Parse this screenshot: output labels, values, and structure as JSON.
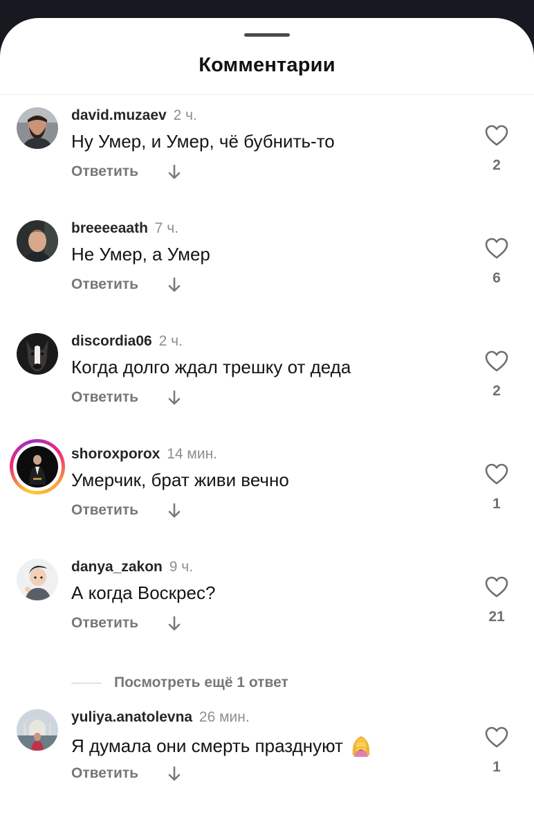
{
  "sheet": {
    "title": "Комментарии"
  },
  "comments": [
    {
      "username": "david.muzaev",
      "time": "2 ч.",
      "text": "Ну Умер, и Умер, чё бубнить-то",
      "reply_label": "Ответить",
      "likes": "2",
      "avatar_icon": "bearded-man-photo"
    },
    {
      "username": "breeeeaath",
      "time": "7 ч.",
      "text": "Не Умер, а Умер",
      "reply_label": "Ответить",
      "likes": "6",
      "avatar_icon": "man-portrait-photo"
    },
    {
      "username": "discordia06",
      "time": "2 ч.",
      "text": "Когда долго ждал трешку от деда",
      "reply_label": "Ответить",
      "likes": "2",
      "avatar_icon": "dog-photo"
    },
    {
      "username": "shoroxporox",
      "time": "14 мин.",
      "text": "Умерчик, брат живи вечно",
      "reply_label": "Ответить",
      "likes": "1",
      "avatar_icon": "man-in-suit-photo",
      "has_story_ring": true
    },
    {
      "username": "danya_zakon",
      "time": "9 ч.",
      "text": "А когда Воскрес?",
      "reply_label": "Ответить",
      "likes": "21",
      "avatar_icon": "cartoon-avatar"
    },
    {
      "username": "yuliya.anatolevna",
      "time": "26 мин.",
      "text": "Я думала они смерть празднуют",
      "reply_label": "Ответить",
      "likes": "1",
      "avatar_icon": "woman-at-taj-mahal-photo",
      "emoji": "woman-facepalming-emoji"
    }
  ],
  "view_more_replies": "Посмотреть ещё 1 ответ",
  "colors": {
    "background_dark": "#161a20",
    "sheet": "#ffffff",
    "username": "#262626",
    "secondary_text": "#8e8e8e",
    "action_text": "#777777"
  }
}
